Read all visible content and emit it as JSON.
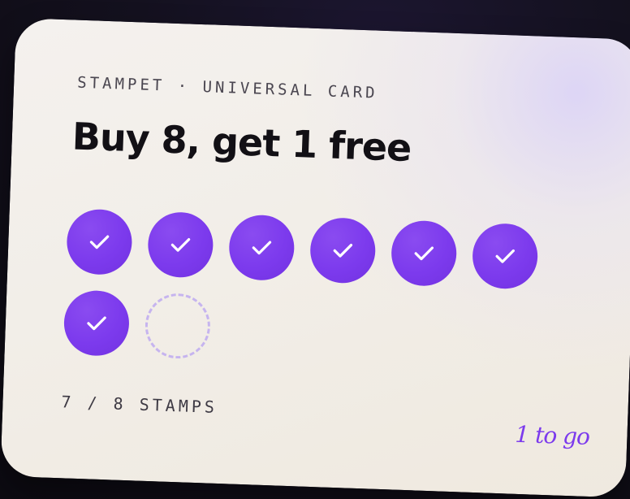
{
  "card": {
    "eyebrow": "STAMPET · UNIVERSAL CARD",
    "title": "Buy 8, get 1 free",
    "progress_label": "7 / 8 STAMPS",
    "remaining_label": "1 to go"
  },
  "stamps": {
    "collected": 7,
    "total": 8,
    "items": [
      {
        "state": "filled",
        "icon": "check-icon"
      },
      {
        "state": "filled",
        "icon": "check-icon"
      },
      {
        "state": "filled",
        "icon": "check-icon"
      },
      {
        "state": "filled",
        "icon": "check-icon"
      },
      {
        "state": "filled",
        "icon": "check-icon"
      },
      {
        "state": "filled",
        "icon": "check-icon"
      },
      {
        "state": "filled",
        "icon": "check-icon"
      },
      {
        "state": "empty",
        "icon": ""
      }
    ]
  },
  "colors": {
    "accent": "#7c3aed",
    "empty_outline": "#c6b4ef",
    "card_background": "#f2eee8",
    "page_background": "#14111f"
  }
}
